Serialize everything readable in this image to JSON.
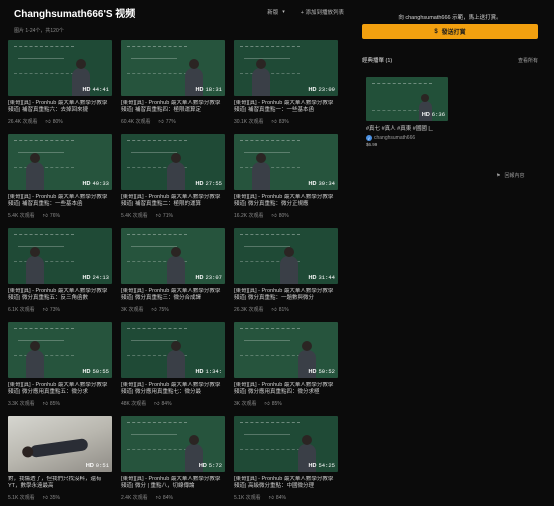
{
  "page": {
    "title": "Changhsumath666'S 视频",
    "sort_label": "新版",
    "sort_caret": "▾",
    "add_playlist": "+ 添加到播放列表",
    "meta": "图片 1-24个，共120个"
  },
  "videos": [
    {
      "thumb": "teacher-right",
      "duration": "44:41",
      "title": "[東哥][真] - Pronhub 最大華人數學分教學頻道| 補習真重點六：去掉回來捷",
      "views": "26.4K 次观看",
      "likes": "80%"
    },
    {
      "thumb": "teacher-right",
      "duration": "18:31",
      "title": "[東哥][真] - Pronhub 最大華人數學分教學頻道| 補習真重點四：極限運算定",
      "views": "60.4K 次观看",
      "likes": "77%"
    },
    {
      "thumb": "teacher-left",
      "duration": "23:09",
      "title": "[東哥][真] - Pronhub 最大華人數學分教學頻道| 補習真重點一：一些基本函",
      "views": "30.1K 次观看",
      "likes": "83%"
    },
    {
      "thumb": "teacher-left",
      "duration": "40:33",
      "title": "[東哥][真] - Pronhub 最大華人數學分教學頻道| 補習真重點：一些基本函",
      "views": "5.4K 次观看",
      "likes": "76%"
    },
    {
      "thumb": "teacher-mid",
      "duration": "27:55",
      "title": "[東哥][真] - Pronhub 最大華人數學分教學頻道| 補習真重點二：極限的運算",
      "views": "5.4K 次观看",
      "likes": "71%"
    },
    {
      "thumb": "teacher-left",
      "duration": "39:34",
      "title": "[東哥][真] - Pronhub 最大華人數學分教學頻道| 微分真重點：微分正規應",
      "views": "16.2K 次观看",
      "likes": "80%"
    },
    {
      "thumb": "teacher-left",
      "duration": "24:13",
      "title": "[東哥][真] - Pronhub 最大華人數學分教學頻道| 微分真重點五：反三角函數",
      "views": "6.1K 次观看",
      "likes": "73%"
    },
    {
      "thumb": "teacher-mid",
      "duration": "23:07",
      "title": "[東哥][真] - Pronhub 最大華人數學分教學頻道| 微分真重點三：微分合成譯",
      "views": "3K 次观看",
      "likes": "75%"
    },
    {
      "thumb": "teacher-mid",
      "duration": "31:44",
      "title": "[東哥][真] - Pronhub 最大華人數學分教學頻道| 微分真重點：一題數與微分",
      "views": "26.3K 次观看",
      "likes": "81%"
    },
    {
      "thumb": "teacher-left",
      "duration": "50:55",
      "title": "[東哥][真] - Pronhub 最大華人數學分教學頻道| 微分應用真重點五：微分求",
      "views": "3.3K 次观看",
      "likes": "85%"
    },
    {
      "thumb": "teacher-mid",
      "duration": "1:34:",
      "title": "[東哥][真] - Pronhub 最大華人數學分教學頻道| 微分應用真重點七：微分最",
      "views": "48K 次观看",
      "likes": "84%"
    },
    {
      "thumb": "teacher-right",
      "duration": "50:52",
      "title": "[東哥][真] - Pronhub 最大華人數學分教學頻道| 微分應用真重點四：微分求極",
      "views": "3K 次观看",
      "likes": "85%"
    },
    {
      "thumb": "photo",
      "duration": "0:51",
      "title": "對，我傷透了，但我們只找沒料，還有 YT，數學永遠最高",
      "views": "5.1K 次观看",
      "likes": "35%"
    },
    {
      "thumb": "teacher-right",
      "duration": "5:72",
      "title": "[東哥][真] - Pronhub 最大華人數學分教學頻道| 微分 | 重點八，切線傳論",
      "views": "2.4K 次观看",
      "likes": "84%"
    },
    {
      "thumb": "teacher-right",
      "duration": "54:25",
      "title": "[東哥][真] - Pronhub 最大華人數學分教學頻道| 高級微分重點：中國微分理",
      "views": "5.1K 次观看",
      "likes": "84%"
    }
  ],
  "sidebar": {
    "subscribe_prompt": "向 changhsumath666 示範，馬上送打賞。",
    "subscribe_button": "發送打賞",
    "subscribe_icon": "$",
    "playlists_header": "經典播單 (1)",
    "view_all": "查看所有",
    "playlist": {
      "duration": "6:36",
      "title": "#真七 #真人 #真東 #國國 |_",
      "owner": "changhsumath666",
      "price": "$6.99"
    },
    "report_label": "回報內容"
  },
  "colors": {
    "accent": "#f2a00f",
    "chalkboard": "#1f4a36",
    "background": "#0b0b0b"
  }
}
